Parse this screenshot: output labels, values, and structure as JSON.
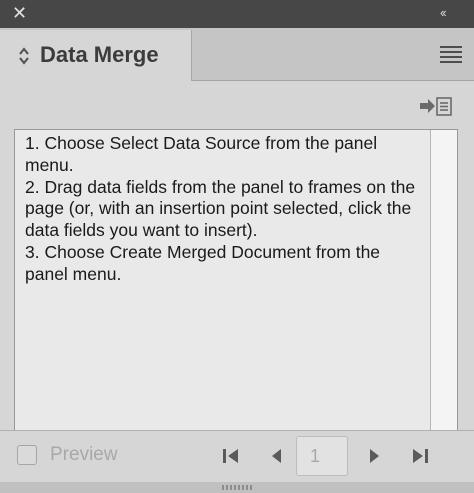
{
  "window": {
    "close_icon": "close-icon",
    "collapse_icon": "double-chevron-left-icon"
  },
  "tab": {
    "title": "Data Merge",
    "icon": "up-down-chevron-icon"
  },
  "panel_menu_icon": "hamburger-menu-icon",
  "toolbar": {
    "insert_icon": "insert-field-icon"
  },
  "instructions": {
    "text": "1. Choose Select Data Source from the panel menu.\n2. Drag data fields from the panel to frames on the page (or, with an insertion point selected, click the data fields you want to insert).\n3. Choose Create Merged Document from the panel menu."
  },
  "footer": {
    "preview_label": "Preview",
    "preview_checked": false,
    "page_number": "1",
    "nav_icons": [
      "first-record-icon",
      "previous-record-icon",
      "next-record-icon",
      "last-record-icon"
    ]
  },
  "colors": {
    "topbar": "#474747",
    "panel_bg": "#d6d6d6",
    "listbox_bg": "#e9e9e9",
    "disabled_text": "#a8a8a8"
  }
}
